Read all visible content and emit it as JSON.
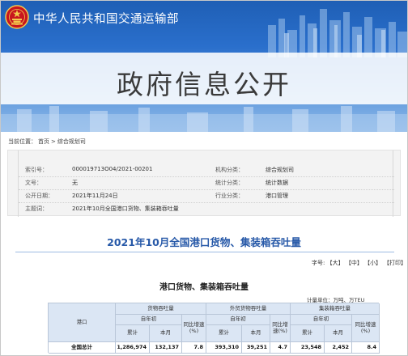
{
  "header": {
    "site_title": "中华人民共和国交通运输部",
    "banner_title": "政府信息公开",
    "accent_color": "#2a6fcc"
  },
  "breadcrumb": {
    "prefix": "当前位置：",
    "items": [
      "首页",
      "综合规划司"
    ],
    "separator": ">"
  },
  "meta": {
    "rows": [
      {
        "k1": "索引号：",
        "v1": "000019713O04/2021-00201",
        "k2": "机构分类：",
        "v2": "综合规划司"
      },
      {
        "k1": "文号：",
        "v1": "无",
        "k2": "统计分类：",
        "v2": "统计数据"
      },
      {
        "k1": "公开日期：",
        "v1": "2021年11月24日",
        "k2": "行业分类：",
        "v2": "港口管理"
      },
      {
        "k1": "主题词：",
        "v1": "2021年10月全国港口货物、集装箱吞吐量",
        "k2": "",
        "v2": ""
      }
    ]
  },
  "article": {
    "title": "2021年10月全国港口货物、集装箱吞吐量",
    "font_label": "字号:",
    "font_sizes": [
      "【大】",
      "【中】",
      "【小】"
    ],
    "print_label": "【打印】",
    "table_title": "港口货物、集装箱吞吐量",
    "unit": "计量单位：万吨、万TEU"
  },
  "table": {
    "h_port": "港口",
    "h_cargo": "货物吞吐量",
    "h_foreign": "外贸货物吞吐量",
    "h_container": "集装箱吞吐量",
    "h_ytd": "自年初",
    "h_cum": "累计",
    "h_month": "本月",
    "h_yoy": "同比增速(%)",
    "h_yoy2": "同比增速(%)",
    "row_label": "全国总计",
    "row": [
      "1,286,974",
      "132,137",
      "7.8",
      "393,310",
      "39,251",
      "4.7",
      "23,548",
      "2,452",
      "8.4"
    ]
  }
}
